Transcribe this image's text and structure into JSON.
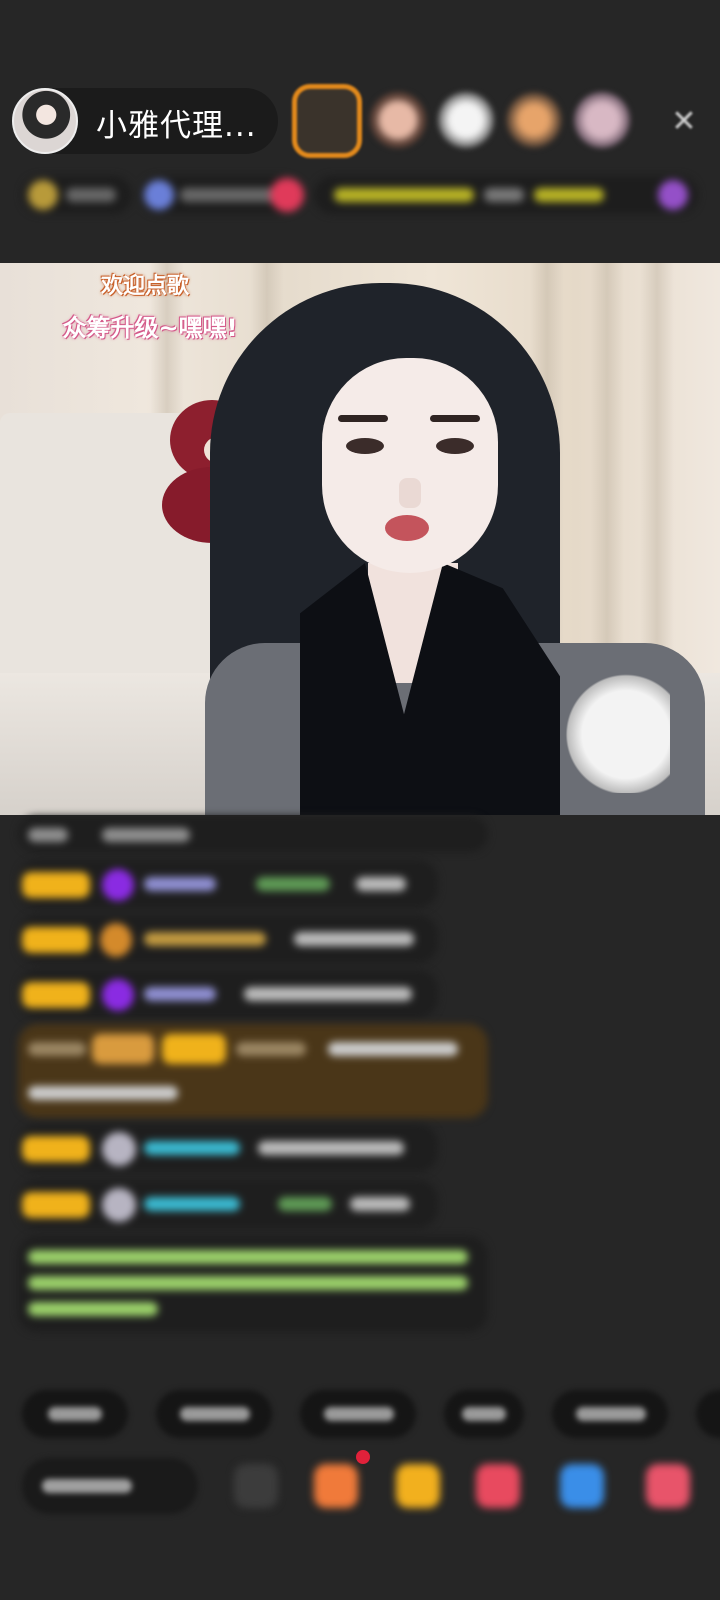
{
  "host": {
    "name": "小雅代理...",
    "avatar_icon": "host-avatar"
  },
  "header": {
    "close_icon": "close-icon",
    "close_glyph": "✕",
    "viewer_count_visible": 5
  },
  "video": {
    "overlay_line_1": "欢迎点歌",
    "overlay_line_2": "众筹升级~嘿嘿!"
  },
  "colors": {
    "background": "#262626",
    "badge_gold": "#f0b21b",
    "gift_orange": "#e38a1c",
    "diamond_purple": "#8a2be2",
    "system_green": "#9bd16a",
    "user_cyan": "#3ab8cf"
  }
}
